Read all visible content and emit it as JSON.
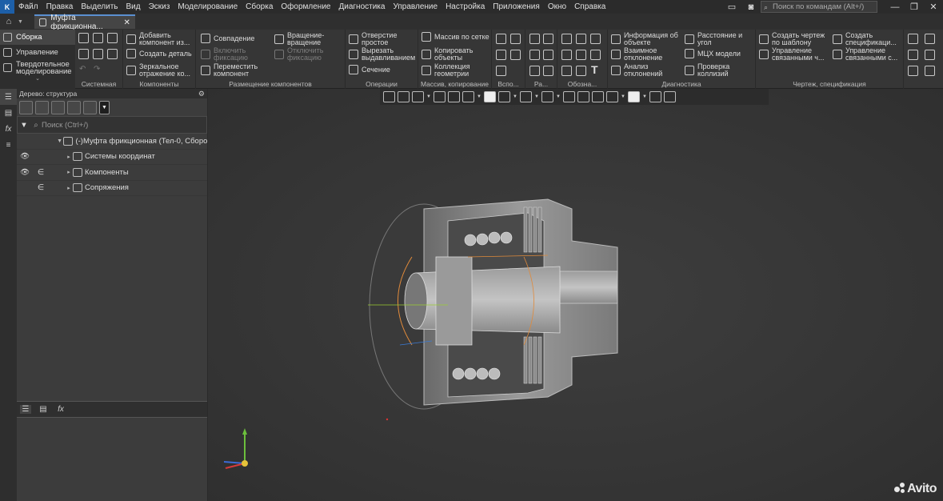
{
  "menu": {
    "items": [
      "Файл",
      "Правка",
      "Выделить",
      "Вид",
      "Эскиз",
      "Моделирование",
      "Сборка",
      "Оформление",
      "Диагностика",
      "Управление",
      "Настройка",
      "Приложения",
      "Окно",
      "Справка"
    ],
    "search_placeholder": "Поиск по командам (Alt+/)"
  },
  "tabs": {
    "doc_title": "Муфта фрикционна..."
  },
  "ribbon": {
    "categories": [
      "Сборка",
      "Управление",
      "Твердотельное моделирование"
    ],
    "groups": {
      "system": "Системная",
      "components": "Компоненты",
      "placement": "Размещение компонентов",
      "operations": "Операции",
      "array": "Массив, копирование",
      "aux": "Вспо...",
      "ra": "Ра...",
      "oboz": "Обозна...",
      "diag": "Диагностика",
      "drawing": "Чертеж, спецификация"
    },
    "buttons": {
      "add_component": "Добавить компонент из...",
      "create_part": "Создать деталь",
      "mirror": "Зеркальное отражение ко...",
      "coincidence": "Совпадение",
      "enable_fix": "Включить фиксацию",
      "move_component": "Переместить компонент",
      "rotation": "Вращение-вращение",
      "disable_fix": "Отключить фиксацию",
      "simple_hole": "Отверстие простое",
      "cut_extrude": "Вырезать выдавливанием",
      "section": "Сечение",
      "grid_array": "Массив по сетке",
      "copy_objects": "Копировать объекты",
      "geometry_collection": "Коллекция геометрии",
      "object_info": "Информация об объекте",
      "mutual_deviation": "Взаимное отклонение",
      "deviation_analysis": "Анализ отклонений",
      "distance_angle": "Расстояние и угол",
      "mass_props": "МЦХ модели",
      "collision_check": "Проверка коллизий",
      "create_drawing": "Создать чертеж по шаблону",
      "manage_linked_ch": "Управление связанными ч...",
      "create_spec": "Создать спецификаци...",
      "manage_linked_c": "Управление связанными с..."
    }
  },
  "tree": {
    "panel_title": "Дерево: структура",
    "search_placeholder": "Поиск (Ctrl+/)",
    "rows": [
      {
        "label": "(-)Муфта фрикционная (Тел-0, Сбороч",
        "visible": false
      },
      {
        "label": "Системы координат",
        "visible": true
      },
      {
        "label": "Компоненты",
        "visible": true
      },
      {
        "label": "Сопряжения",
        "visible": false
      }
    ]
  },
  "watermark": "Avito",
  "icons": [
    "home-icon",
    "close-icon",
    "search-icon",
    "eye-icon",
    "filter-icon",
    "gear-icon",
    "tree-icon",
    "fx-icon"
  ]
}
